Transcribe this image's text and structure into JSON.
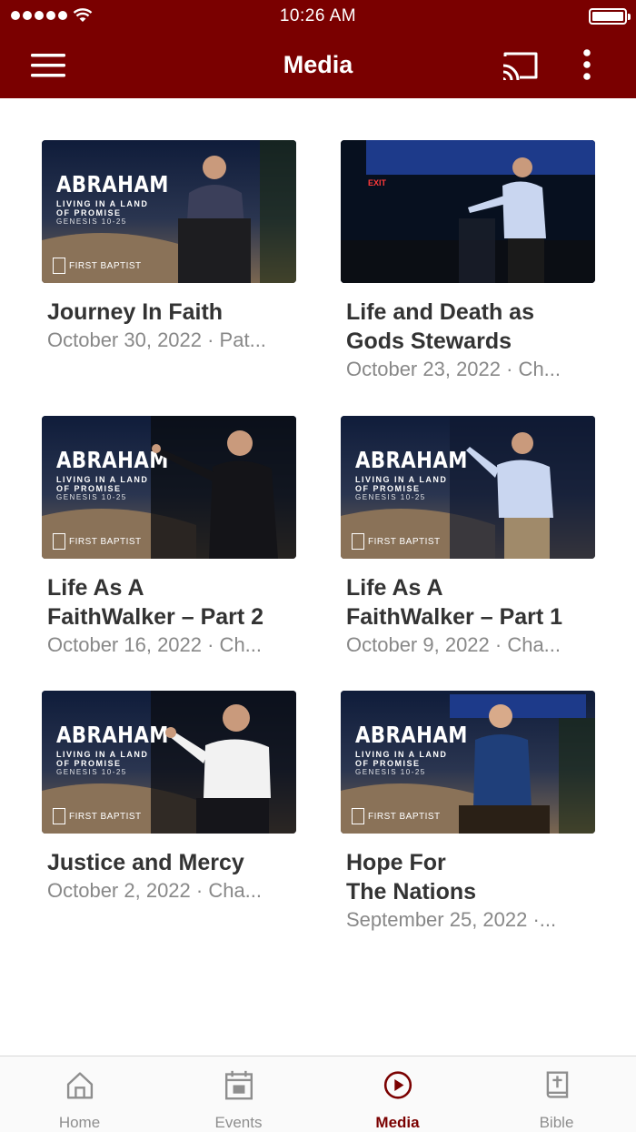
{
  "status_bar": {
    "time": "10:26 AM"
  },
  "header": {
    "title": "Media"
  },
  "media": [
    {
      "title": "Journey In Faith",
      "meta": "October 30, 2022 · Pat...",
      "thumb": {
        "brand": "ABRAHAM",
        "sub": "LIVING IN A LAND\nOF PROMISE",
        "ref": "GENESIS 10-25",
        "church": "FIRST BAPTIST"
      }
    },
    {
      "title": "Life and Death as\nGods Stewards",
      "meta": "October 23, 2022 · Ch...",
      "thumb": {
        "exit_sign": "EXIT"
      }
    },
    {
      "title": "Life As A\nFaithWalker – Part 2",
      "meta": "October 16, 2022 · Ch...",
      "thumb": {
        "brand": "ABRAHAM",
        "sub": "LIVING IN A LAND\nOF PROMISE",
        "ref": "GENESIS 10-25",
        "church": "FIRST BAPTIST"
      }
    },
    {
      "title": "Life As A\nFaithWalker – Part 1",
      "meta": "October 9, 2022 · Cha...",
      "thumb": {
        "brand": "ABRAHAM",
        "sub": "LIVING IN A LAND\nOF PROMISE",
        "ref": "GENESIS 10-25",
        "church": "FIRST BAPTIST"
      }
    },
    {
      "title": "Justice and Mercy",
      "meta": "October 2, 2022 · Cha...",
      "thumb": {
        "brand": "ABRAHAM",
        "sub": "LIVING IN A LAND\nOF PROMISE",
        "ref": "GENESIS 10-25",
        "church": "FIRST BAPTIST"
      }
    },
    {
      "title": "Hope For\nThe Nations",
      "meta": "September 25, 2022 ·...",
      "thumb": {
        "brand": "ABRAHAM",
        "sub": "LIVING IN A LAND\nOF PROMISE",
        "ref": "GENESIS 10-25",
        "church": "FIRST BAPTIST"
      }
    }
  ],
  "tabs": [
    {
      "label": "Home",
      "icon": "home-icon",
      "active": false
    },
    {
      "label": "Events",
      "icon": "calendar-icon",
      "active": false
    },
    {
      "label": "Media",
      "icon": "play-circle-icon",
      "active": true
    },
    {
      "label": "Bible",
      "icon": "bible-icon",
      "active": false
    }
  ],
  "colors": {
    "brand": "#7a0000",
    "inactive_tab": "#8e8e8e",
    "title_text": "#333333",
    "meta_text": "#888888"
  }
}
